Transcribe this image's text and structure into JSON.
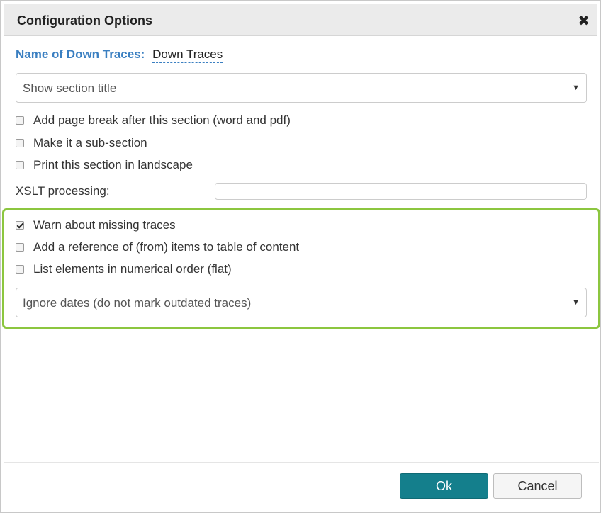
{
  "dialog": {
    "title": "Configuration Options",
    "close_icon": "close-icon"
  },
  "name": {
    "label": "Name of Down Traces:",
    "value": "Down Traces"
  },
  "section_title_select": {
    "selected": "Show section title"
  },
  "options": [
    {
      "label": "Add page break after this section (word and pdf)",
      "checked": false
    },
    {
      "label": "Make it a sub-section",
      "checked": false
    },
    {
      "label": "Print this section in landscape",
      "checked": false
    }
  ],
  "xslt": {
    "label": "XSLT processing:",
    "value": ""
  },
  "highlighted_options": [
    {
      "label": "Warn about missing traces",
      "checked": true
    },
    {
      "label": "Add a reference of (from) items to table of content",
      "checked": false
    },
    {
      "label": "List elements in numerical order (flat)",
      "checked": false
    }
  ],
  "dates_select": {
    "selected": "Ignore dates (do not mark outdated traces)"
  },
  "highlight_color": "#8cc63f",
  "buttons": {
    "ok": "Ok",
    "cancel": "Cancel",
    "ok_color": "#147f8c"
  }
}
